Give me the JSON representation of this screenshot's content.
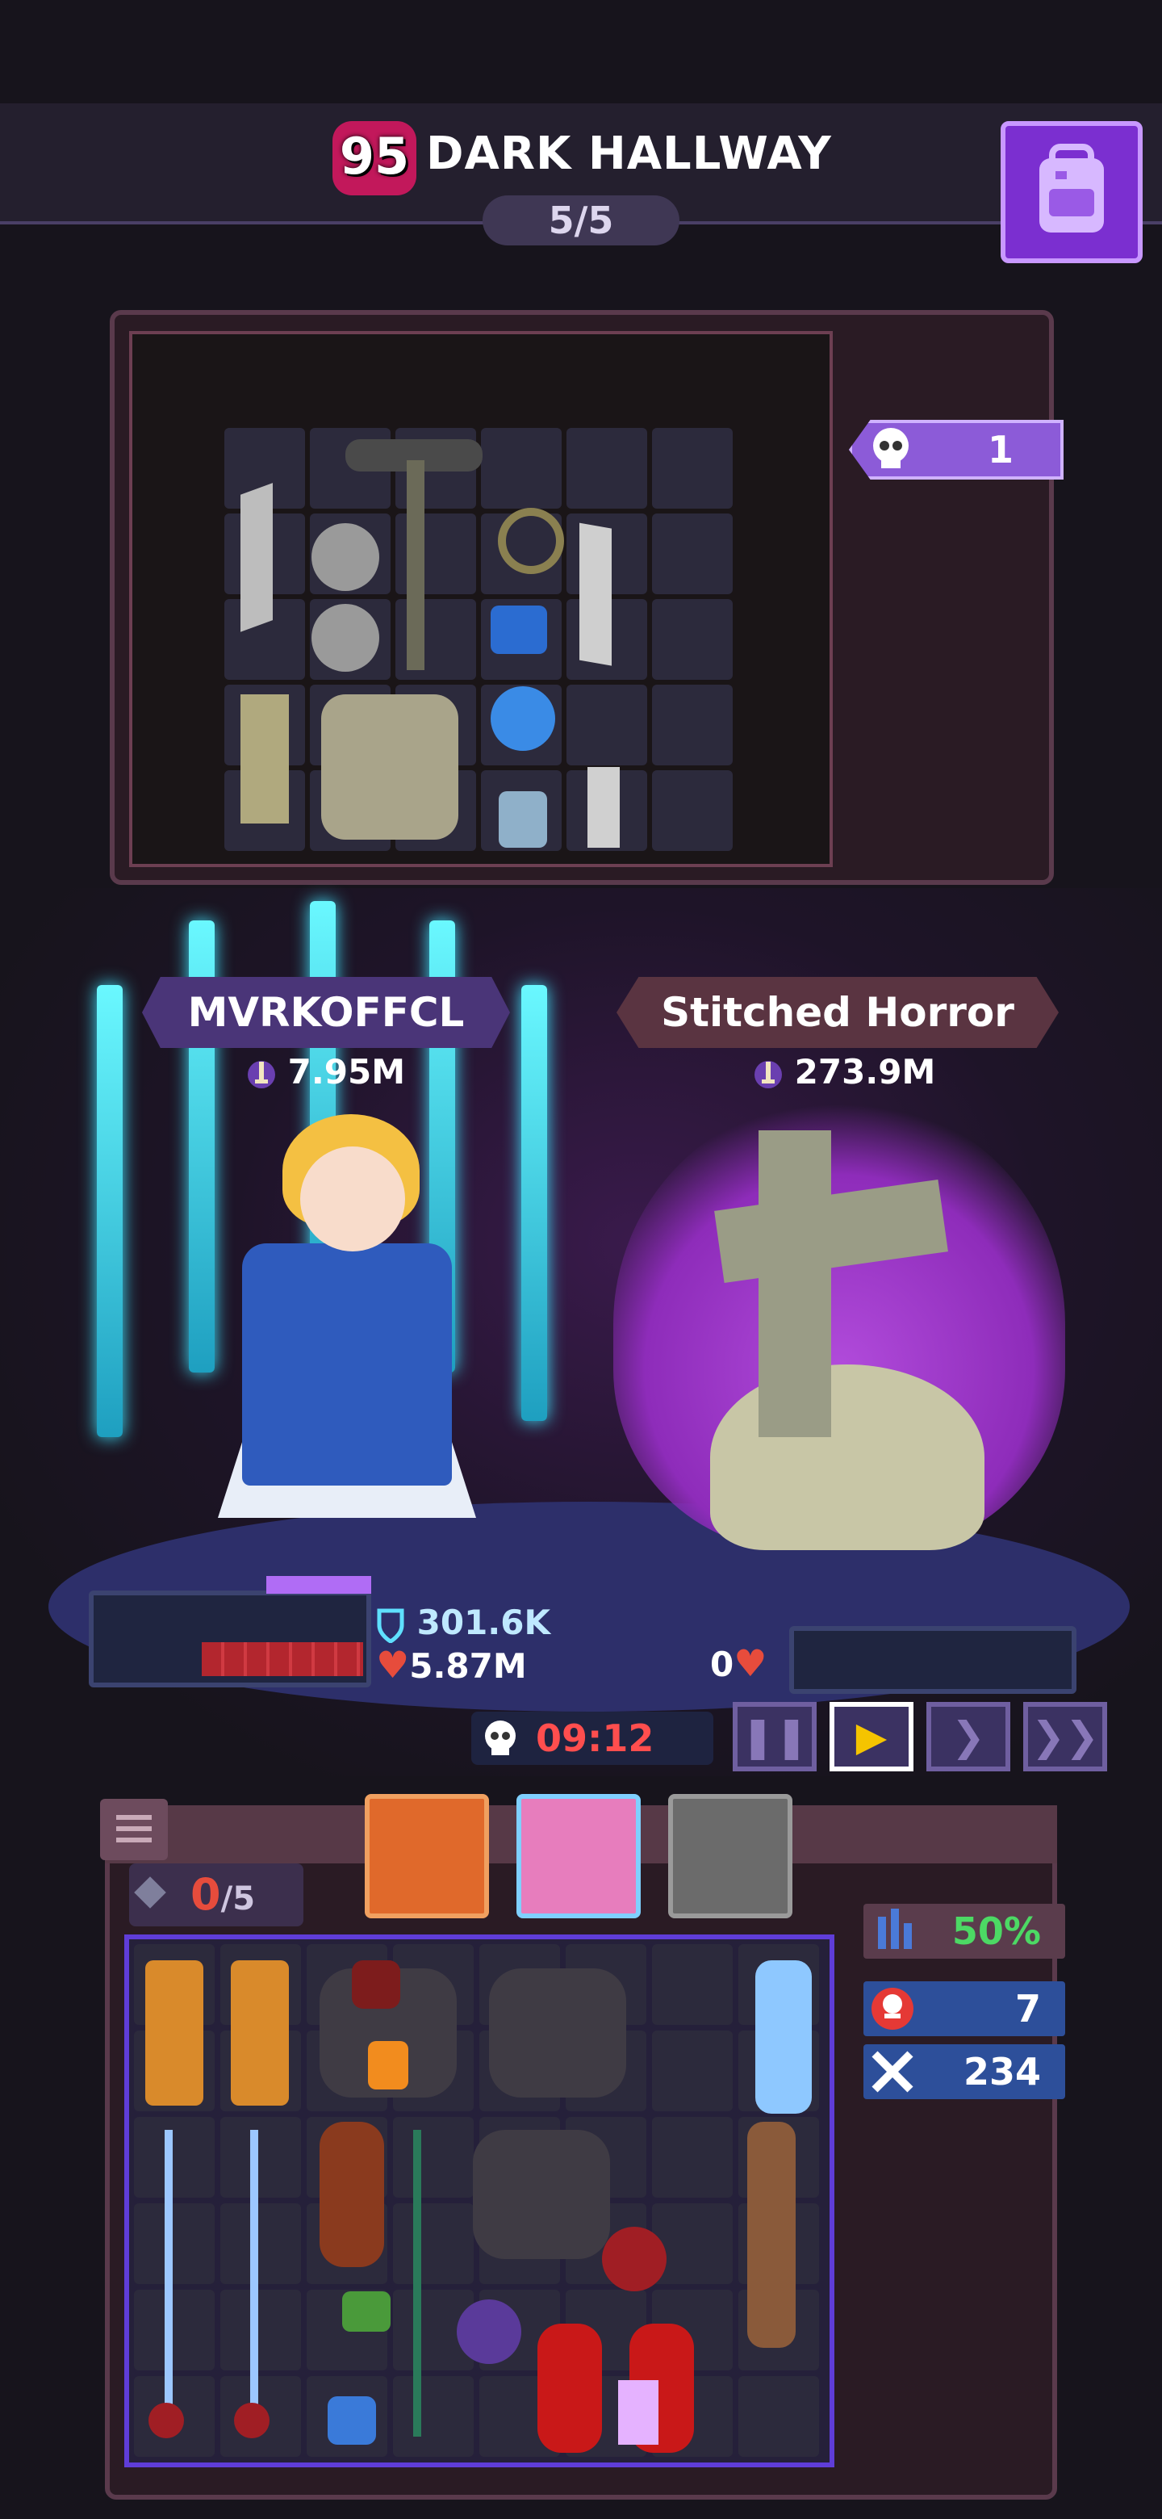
{
  "header": {
    "level": "95",
    "area_title": "DARK HALLWAY",
    "wave": "5/5"
  },
  "loot": {
    "skull_count": "1"
  },
  "player": {
    "name": "MVRKOFFCL",
    "attack": "7.95M",
    "shield": "301.6K",
    "hp": "5.87M"
  },
  "enemy": {
    "name": "Stitched Horror",
    "attack": "273.9M",
    "hp": "0"
  },
  "battle": {
    "timer": "09:12",
    "controls": [
      "pause",
      "play",
      "fast",
      "faster"
    ],
    "active_control": "play"
  },
  "bag": {
    "slot_used": "0",
    "slot_total": "/5",
    "stats": {
      "percent": "50%",
      "kills": "7",
      "crosses": "234"
    }
  },
  "colors": {
    "accent_purple": "#7b2fd0",
    "enemy_flame": "#b14bdb",
    "hp_red": "#e74c3c",
    "timer_red": "#ff4e4e",
    "percent_green": "#4cd964",
    "cyan_blade": "#41e6ff"
  }
}
